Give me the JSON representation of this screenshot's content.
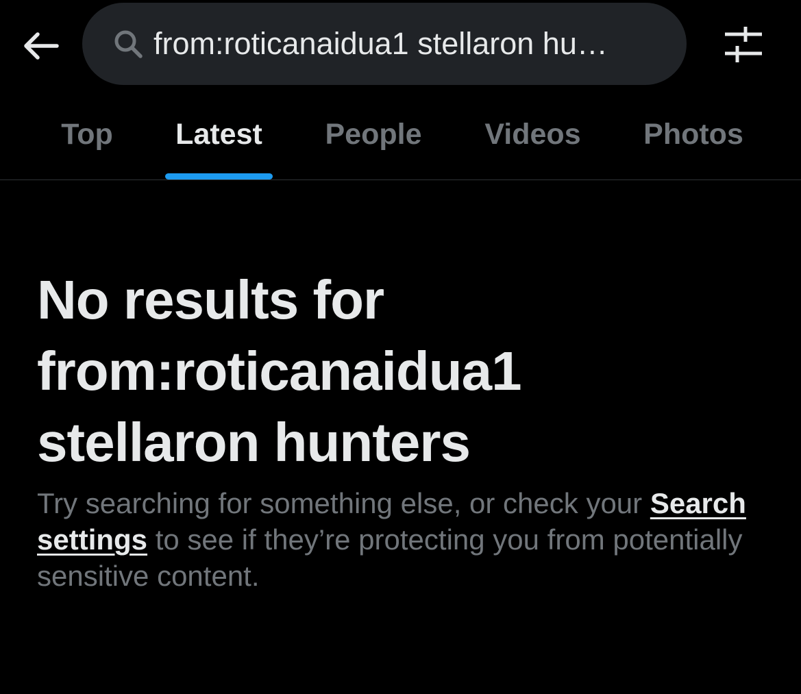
{
  "header": {
    "back_icon": "arrow-left-icon",
    "search": {
      "icon": "search-icon",
      "value": "from:roticanaidua1 stellaron hu…",
      "placeholder": "Search"
    },
    "filter_icon": "sliders-icon"
  },
  "tabs": [
    {
      "label": "Top",
      "active": false
    },
    {
      "label": "Latest",
      "active": true
    },
    {
      "label": "People",
      "active": false
    },
    {
      "label": "Videos",
      "active": false
    },
    {
      "label": "Photos",
      "active": false
    }
  ],
  "empty_state": {
    "title_lines": [
      "No results for",
      "from:roticanaidua1",
      "stellaron hunters"
    ],
    "body_before_link": "Try searching for something else, or check your ",
    "link_label": "Search settings",
    "body_after_link": " to see if they’re protecting you from potentially sensitive content."
  },
  "colors": {
    "background": "#000000",
    "text_primary": "#e7e9ea",
    "text_secondary": "#71767b",
    "accent": "#1d9bf0",
    "search_field": "#202327",
    "divider": "#2f3336"
  }
}
